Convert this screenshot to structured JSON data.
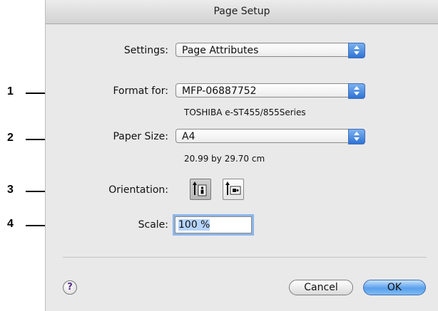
{
  "window": {
    "title": "Page Setup"
  },
  "callouts": [
    "1",
    "2",
    "3",
    "4"
  ],
  "settings": {
    "label": "Settings:",
    "value": "Page Attributes"
  },
  "format_for": {
    "label": "Format for:",
    "value": "MFP-06887752",
    "printer_description": "TOSHIBA e-ST455/855Series"
  },
  "paper_size": {
    "label": "Paper Size:",
    "value": "A4",
    "dimensions": "20.99 by 29.70 cm"
  },
  "orientation": {
    "label": "Orientation:",
    "options": [
      "portrait",
      "landscape"
    ],
    "selected": "portrait"
  },
  "scale": {
    "label": "Scale:",
    "value": "100 %"
  },
  "buttons": {
    "help": "?",
    "cancel": "Cancel",
    "ok": "OK"
  },
  "colors": {
    "accent": "#3d82df",
    "focus_ring": "#8cb6ea",
    "dialog_bg": "#e9e9e9"
  }
}
